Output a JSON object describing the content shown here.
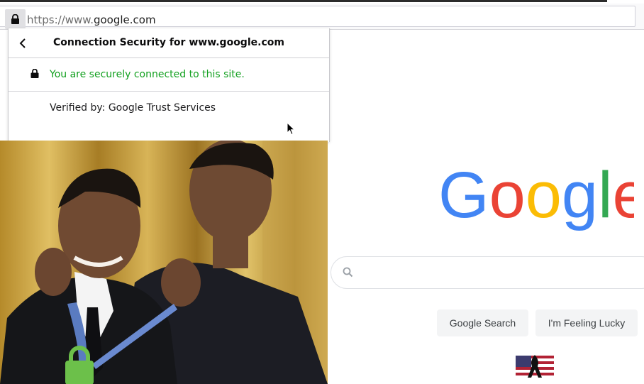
{
  "browser": {
    "url_prefix": "https://www.",
    "url_host": "google.com",
    "lock_icon": "lock-icon"
  },
  "popup": {
    "title": "Connection Security for www.google.com",
    "secure_message": "You are securely connected to this site.",
    "verified_by": "Verified by: Google Trust Services",
    "back_icon": "chevron-left-icon",
    "secure_color": "#12a01f"
  },
  "meme": {
    "lock_color": "#6cc04a"
  },
  "google": {
    "logo_text": "Google",
    "search_value": "",
    "search_button": "Google Search",
    "lucky_button": "I'm Feeling Lucky",
    "colors": {
      "blue": "#4285F4",
      "red": "#EA4335",
      "yellow": "#FBBC05",
      "green": "#34A853"
    }
  }
}
